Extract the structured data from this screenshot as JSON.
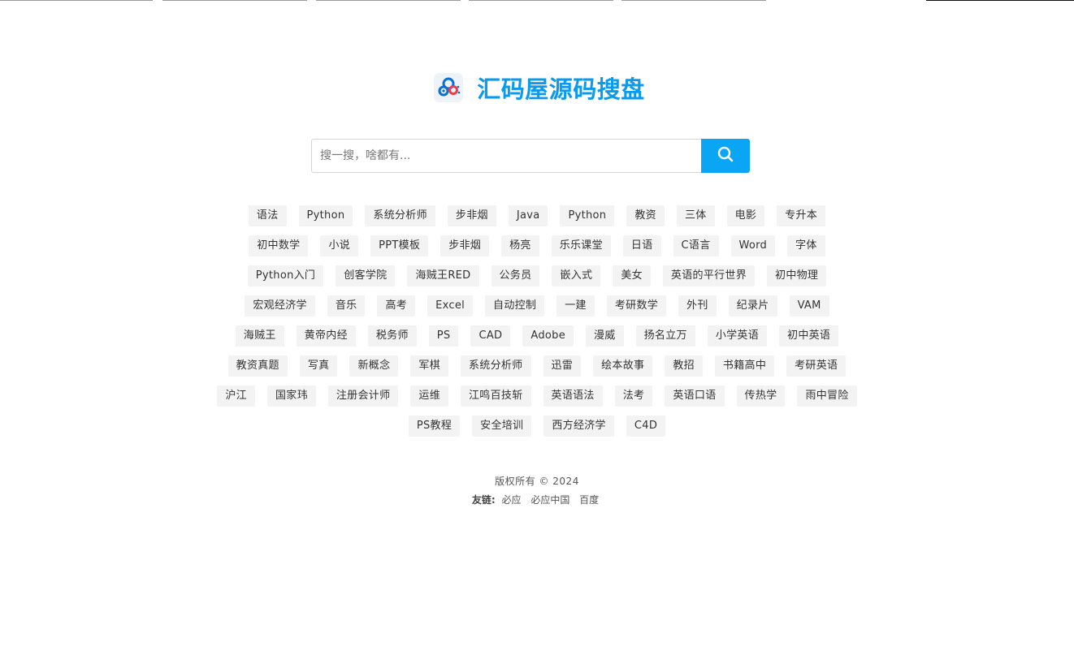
{
  "site": {
    "title": "汇码屋源码搜盘",
    "brand_color": "#0a9bef",
    "logo_icon": "cloud-share-icon"
  },
  "search": {
    "placeholder": "搜一搜，啥都有...",
    "value": "",
    "button_icon": "search-icon",
    "button_color": "#0aa5f5"
  },
  "tags": [
    [
      "语法",
      "Python",
      "系统分析师",
      "步非烟",
      "Java",
      "Python",
      "教资",
      "三体",
      "电影",
      "专升本"
    ],
    [
      "初中数学",
      "小说",
      "PPT模板",
      "步非烟",
      "杨亮",
      "乐乐课堂",
      "日语",
      "C语言",
      "Word",
      "字体"
    ],
    [
      "Python入门",
      "创客学院",
      "海贼王RED",
      "公务员",
      "嵌入式",
      "美女",
      "英语的平行世界",
      "初中物理"
    ],
    [
      "宏观经济学",
      "音乐",
      "高考",
      "Excel",
      "自动控制",
      "一建",
      "考研数学",
      "外刊",
      "纪录片",
      "VAM"
    ],
    [
      "海贼王",
      "黄帝内经",
      "税务师",
      "PS",
      "CAD",
      "Adobe",
      "漫威",
      "扬名立万",
      "小学英语",
      "初中英语"
    ],
    [
      "教资真题",
      "写真",
      "新概念",
      "军棋",
      "系统分析师",
      "迅雷",
      "绘本故事",
      "教招",
      "书籍高中",
      "考研英语"
    ],
    [
      "沪江",
      "国家玮",
      "注册会计师",
      "运维",
      "江鸣百技斩",
      "英语语法",
      "法考",
      "英语口语",
      "传热学",
      "雨中冒险"
    ],
    [
      "PS教程",
      "安全培训",
      "西方经济学",
      "C4D"
    ]
  ],
  "footer": {
    "copyright": "版权所有 © 2024",
    "links_label": "友链:",
    "links": [
      "必应",
      "必应中国",
      "百度"
    ]
  }
}
